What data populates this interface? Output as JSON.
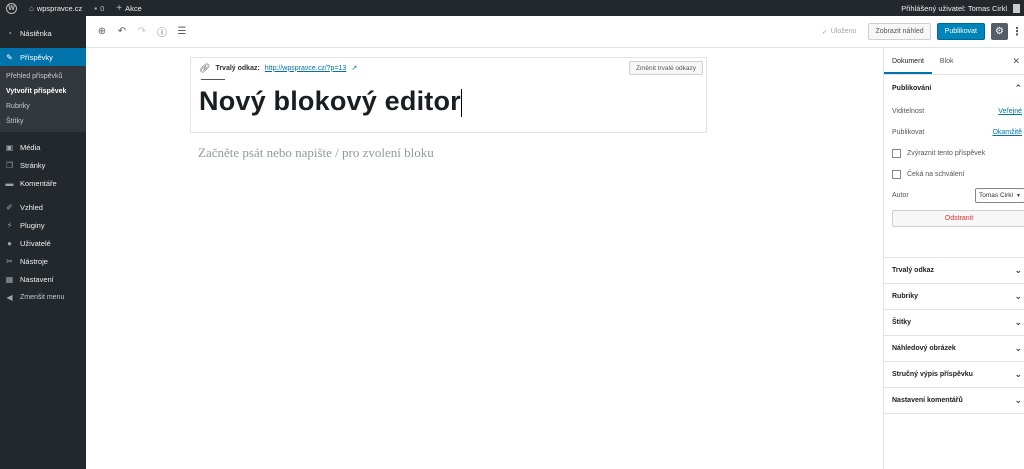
{
  "adminbar": {
    "site_name": "wpspravce.cz",
    "comments_count": "0",
    "new_label": "Akce",
    "user_greeting": "Přihlášený uživatel: Tomas Cirkl"
  },
  "sidebar": {
    "items": [
      {
        "label": "Nástěnka",
        "icon": "dashboard-icon"
      },
      {
        "label": "Příspěvky",
        "icon": "pin-icon"
      },
      {
        "label": "Média",
        "icon": "media-icon"
      },
      {
        "label": "Stránky",
        "icon": "pages-icon"
      },
      {
        "label": "Komentáře",
        "icon": "comments-icon"
      },
      {
        "label": "Vzhled",
        "icon": "appearance-icon"
      },
      {
        "label": "Pluginy",
        "icon": "plugins-icon"
      },
      {
        "label": "Uživatelé",
        "icon": "users-icon"
      },
      {
        "label": "Nástroje",
        "icon": "tools-icon"
      },
      {
        "label": "Nastavení",
        "icon": "settings-icon"
      },
      {
        "label": "Zmenšit menu",
        "icon": "collapse-icon"
      }
    ],
    "submenu": [
      {
        "label": "Přehled příspěvků"
      },
      {
        "label": "Vytvořit příspěvek"
      },
      {
        "label": "Rubriky"
      },
      {
        "label": "Štítky"
      }
    ],
    "accent_color": "#0073aa"
  },
  "header": {
    "saved_label": "Uloženo",
    "preview_label": "Zobrazit náhled",
    "publish_label": "Publikovat"
  },
  "editor": {
    "permalink_label": "Trvalý odkaz:",
    "permalink_url": "http://wpspravce.cz/?p=13",
    "change_permalink_label": "Změnit trvalé odkazy",
    "title": "Nový blokový editor",
    "placeholder": "Začněte psát nebo napište / pro zvolení bloku"
  },
  "settings": {
    "tabs": [
      {
        "label": "Dokument"
      },
      {
        "label": "Blok"
      }
    ],
    "publish_panel": {
      "title": "Publikování",
      "visibility_label": "Viditelnost",
      "visibility_value": "Veřejné",
      "publish_label": "Publikovat",
      "publish_value": "Okamžitě",
      "sticky_label": "Zvýraznit tento příspěvek",
      "pending_label": "Čeká na schválení",
      "author_label": "Autor",
      "author_value": "Tomas Cirkl",
      "delete_label": "Odstranit"
    },
    "panels": [
      {
        "label": "Trvalý odkaz"
      },
      {
        "label": "Rubriky"
      },
      {
        "label": "Štítky"
      },
      {
        "label": "Náhledový obrázek"
      },
      {
        "label": "Stručný výpis příspěvku"
      },
      {
        "label": "Nastavení komentářů"
      }
    ]
  }
}
